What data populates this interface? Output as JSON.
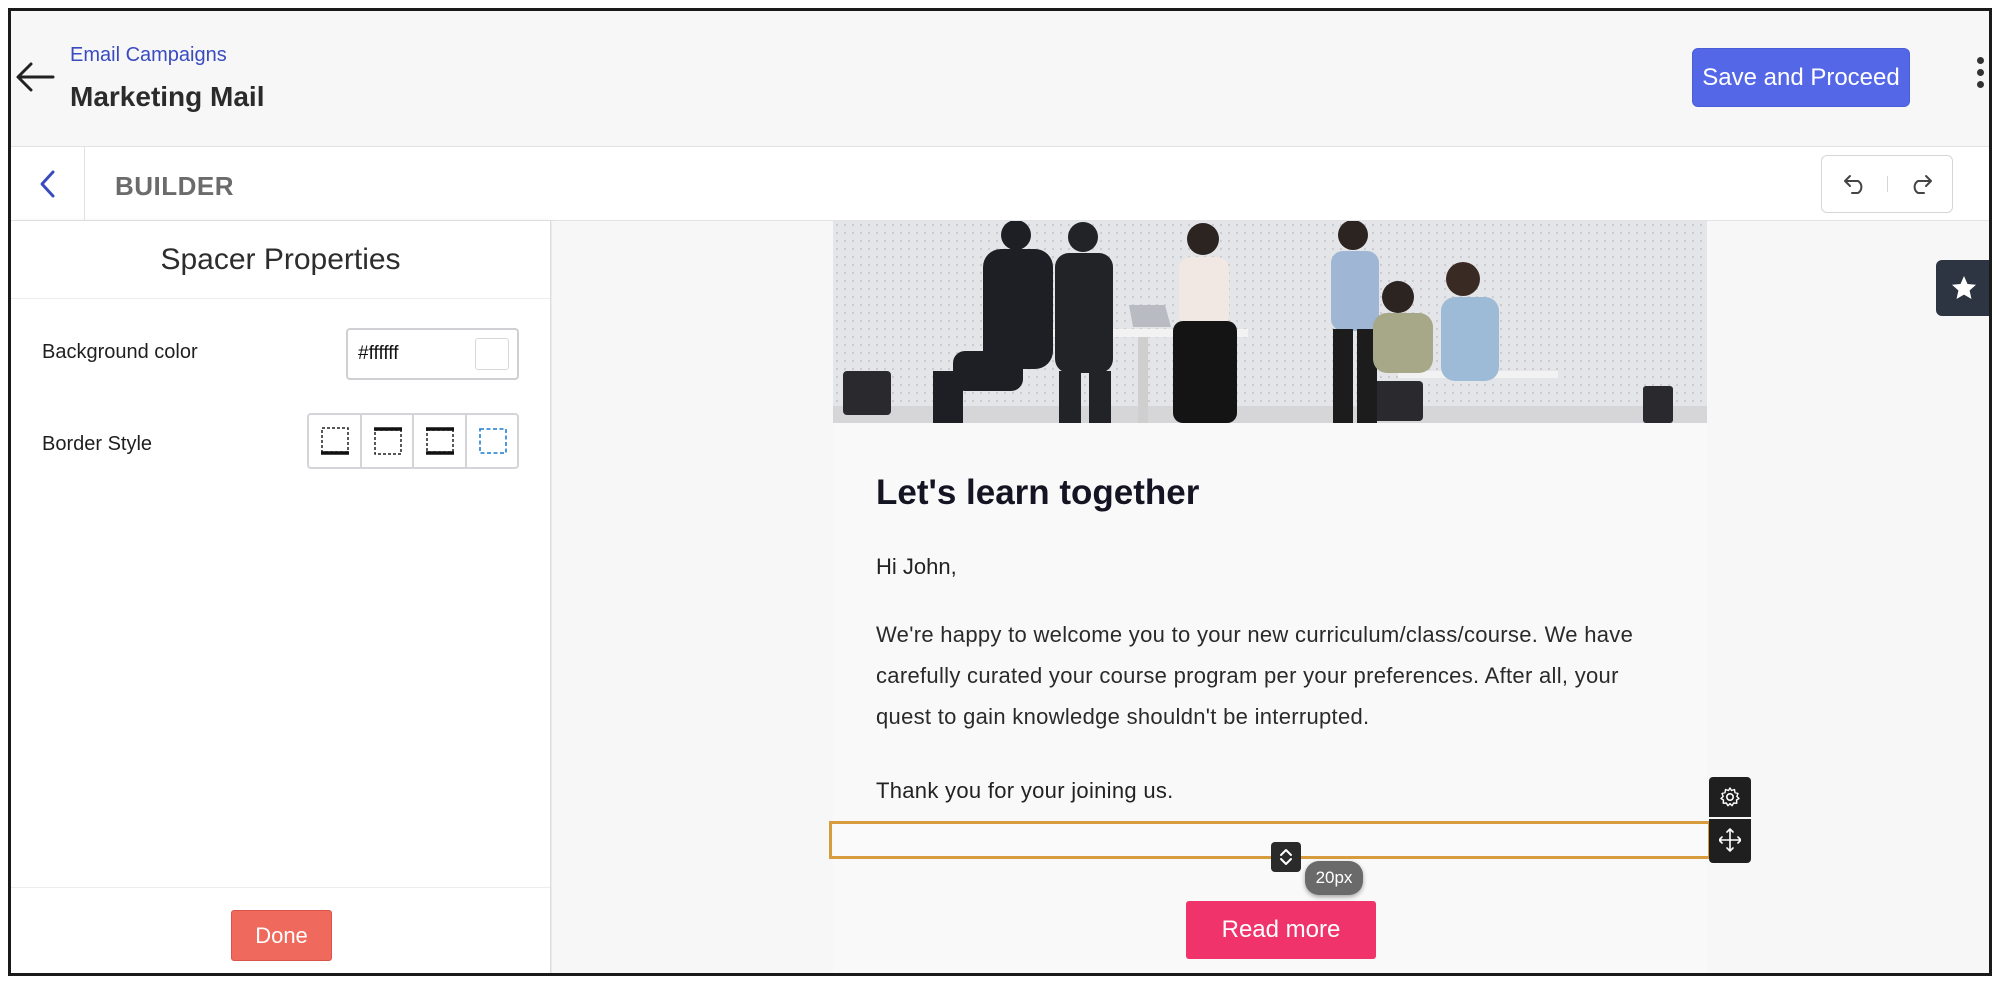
{
  "header": {
    "breadcrumb": "Email Campaigns",
    "title": "Marketing Mail",
    "save_label": "Save and Proceed",
    "icons": {
      "back": "arrow-left-icon",
      "more": "kebab-menu-icon"
    }
  },
  "builder_bar": {
    "label": "BUILDER",
    "icons": {
      "back": "chevron-left-icon",
      "undo": "undo-icon",
      "redo": "redo-icon"
    }
  },
  "properties_panel": {
    "title": "Spacer Properties",
    "background_color": {
      "label": "Background color",
      "value": "#ffffff"
    },
    "border_style": {
      "label": "Border Style",
      "options": [
        "border-bottom-solid",
        "border-top-solid",
        "border-top-bottom-solid",
        "border-all-dashed"
      ],
      "selected": "border-all-dashed"
    },
    "done_label": "Done"
  },
  "email": {
    "hero_image": "students-collaborating-photo",
    "heading": "Let's learn together",
    "greeting": "Hi John,",
    "body": "We're happy to welcome you to your new curriculum/class/course. We have carefully curated your course program per your preferences. After all, your quest to gain knowledge shouldn't be interrupted.",
    "thanks": "Thank you for your joining us.",
    "spacer_height_label": "20px",
    "button_label": "Read more",
    "tools": {
      "settings": "gear-icon",
      "move": "move-icon",
      "resize": "resize-vertical-icon"
    }
  },
  "sidebar_right": {
    "favorite_icon": "star-icon"
  },
  "colors": {
    "primary": "#5468e7",
    "breadcrumb": "#3a4bbf",
    "done": "#f0695d",
    "cta": "#f0336a",
    "spacer_outline": "#d79c3b",
    "dark": "#1f1f1f"
  }
}
